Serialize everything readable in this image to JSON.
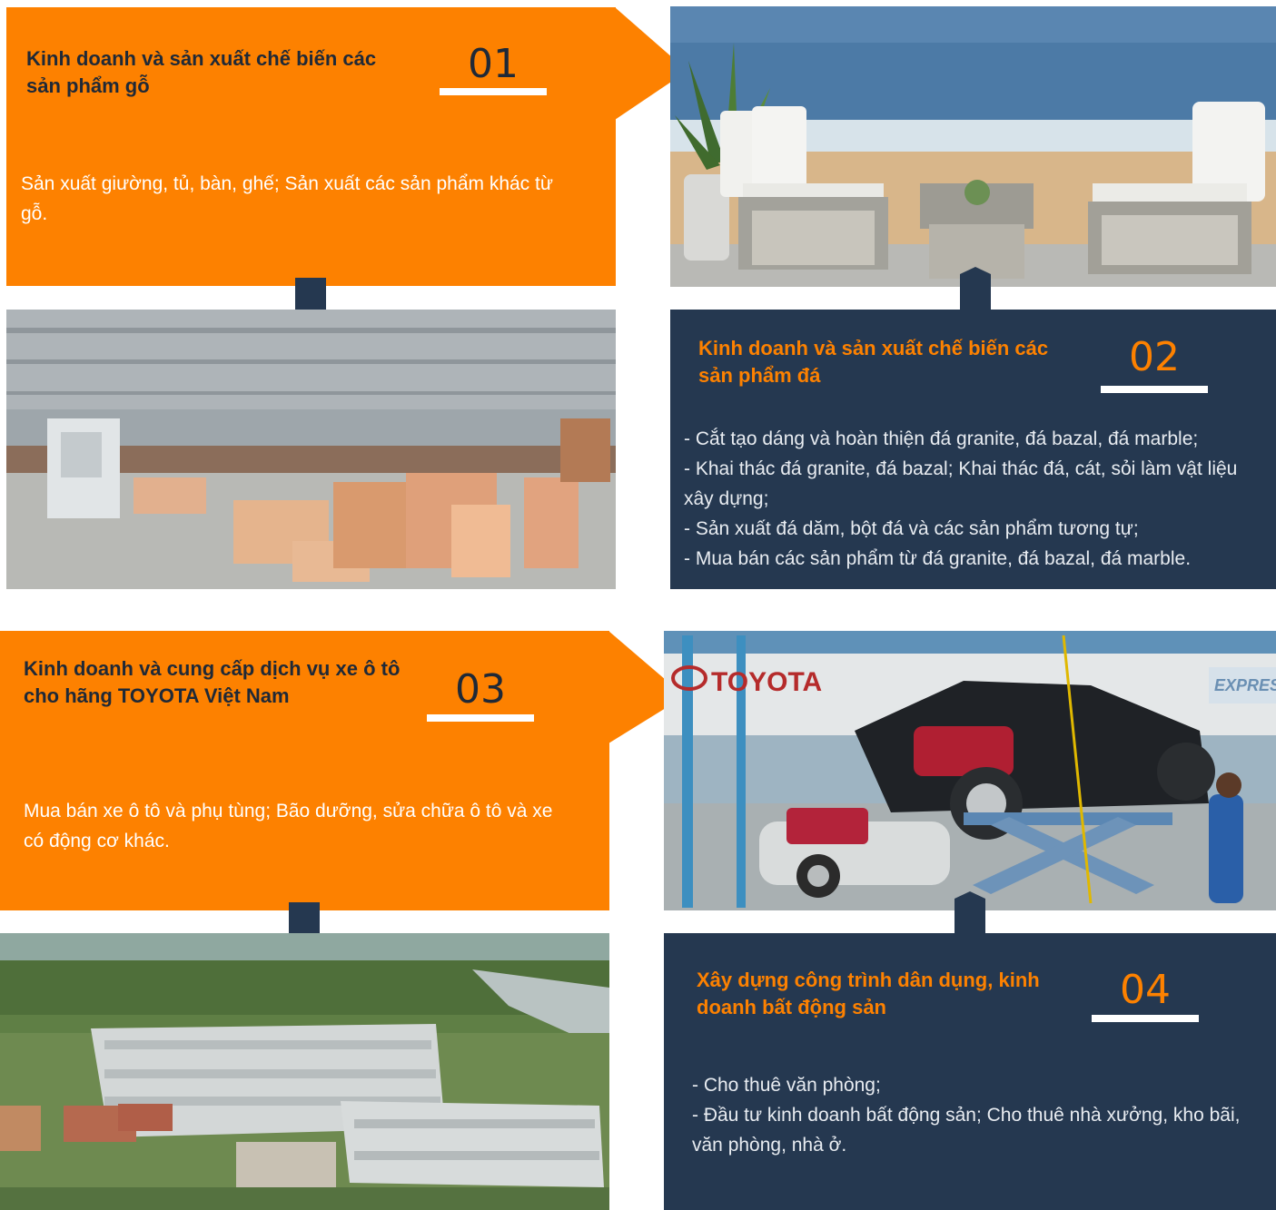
{
  "sections": [
    {
      "number": "01",
      "title": "Kinh doanh và sản xuất chế biến các sản phẩm gỗ",
      "description": "Sản xuất giường, tủ, bàn, ghế; Sản xuất các sản phẩm khác từ gỗ."
    },
    {
      "number": "02",
      "title": "Kinh doanh và sản xuất chế biến các sản phẩm đá",
      "description": "- Cắt tạo dáng và hoàn thiện đá granite, đá bazal, đá marble;\n- Khai thác đá granite, đá bazal; Khai thác đá, cát, sỏi làm vật liệu xây dựng;\n- Sản xuất đá dăm, bột đá và các sản phẩm tương tự;\n- Mua bán các sản phẩm từ đá granite, đá bazal, đá marble."
    },
    {
      "number": "03",
      "title": "Kinh doanh và cung cấp dịch vụ xe ô tô cho hãng TOYOTA Việt Nam",
      "description": "Mua bán xe ô tô và phụ tùng; Bão dưỡng, sửa chữa ô tô và xe có động cơ khác."
    },
    {
      "number": "04",
      "title": "Xây dựng công trình dân dụng, kinh doanh bất động sản",
      "description": "- Cho thuê văn phòng;\n- Đầu tư kinh doanh bất động sản; Cho thuê nhà xưởng, kho bãi, văn phòng, nhà ở."
    }
  ],
  "photos": {
    "toyota_sign": "TOYOTA",
    "express_sign": "EXPRESS"
  },
  "colors": {
    "orange": "#fd8100",
    "navy": "#253850",
    "white": "#ffffff"
  }
}
